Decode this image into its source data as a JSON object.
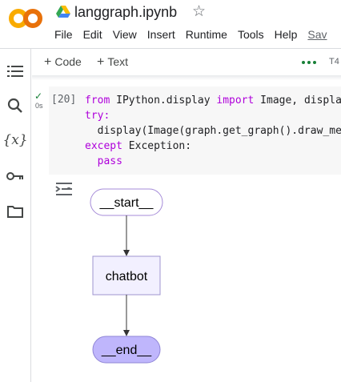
{
  "header": {
    "logo": "colab-logo",
    "drive_icon": "google-drive-icon",
    "title": "langgraph.ipynb",
    "star_icon": "star-outline-icon"
  },
  "menu": {
    "items": [
      "File",
      "Edit",
      "View",
      "Insert",
      "Runtime",
      "Tools",
      "Help"
    ],
    "save_label": "Sav"
  },
  "sidebar": {
    "icons": [
      "table-of-contents-icon",
      "search-icon",
      "variables-icon",
      "key-icon",
      "folder-icon"
    ],
    "variables_glyph": "{x}"
  },
  "toolbar": {
    "add_code": "Code",
    "add_text": "Text",
    "runtime_label": "T4",
    "plus": "+"
  },
  "cell": {
    "exec_count": "[20]",
    "exec_time": "0s",
    "lines": [
      {
        "kw": "from",
        "rest": " IPython.display ",
        "kw2": "import",
        "rest2": " Image, display"
      },
      {
        "kw": "try:",
        "rest": ""
      },
      {
        "rest": "  display(Image(graph.get_graph().draw_mermaid_png()))"
      },
      {
        "kw": "except",
        "rest": " Exception:"
      },
      {
        "kw": "  pass",
        "rest": ""
      }
    ]
  },
  "graph": {
    "nodes": [
      "__start__",
      "chatbot",
      "__end__"
    ],
    "colors": {
      "start_fill": "#ffffff",
      "start_stroke": "#a58bd8",
      "chatbot_fill": "#f2f0ff",
      "chatbot_stroke": "#9f94cf",
      "end_fill": "#bfb6fc",
      "end_stroke": "#8f85d6"
    }
  }
}
